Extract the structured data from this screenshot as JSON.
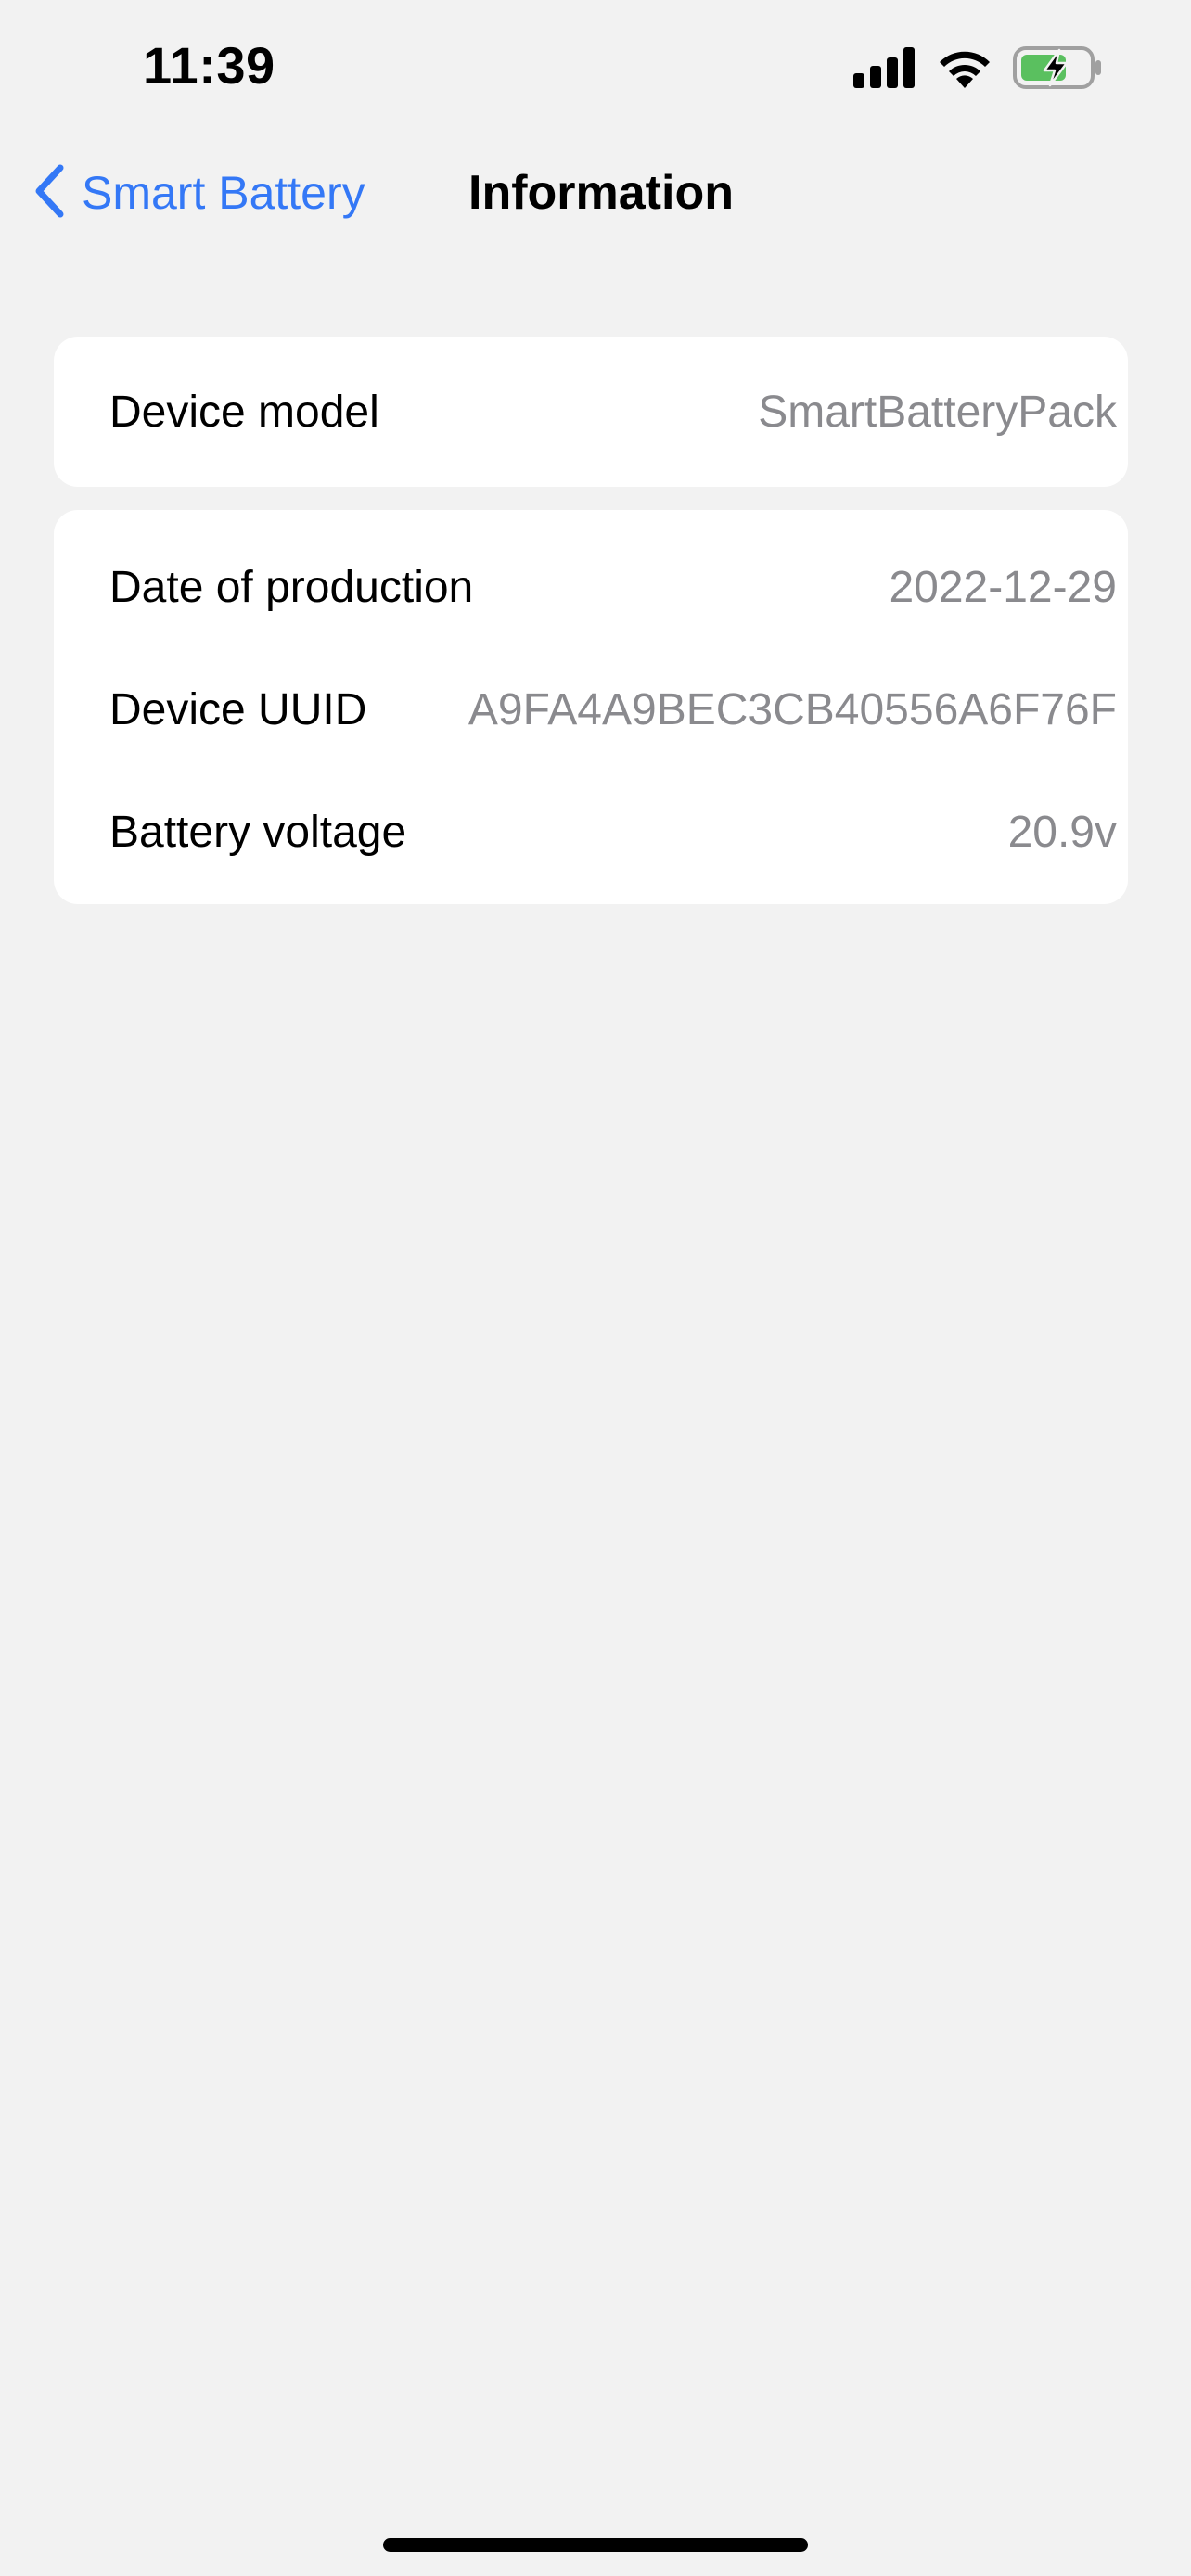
{
  "status_bar": {
    "time": "11:39",
    "icons": [
      "cellular-signal-icon",
      "wifi-icon",
      "battery-charging-icon"
    ],
    "battery_color": "#5ac05f"
  },
  "nav": {
    "back_label": "Smart Battery",
    "back_icon": "chevron-left-icon",
    "title": "Information",
    "accent_color": "#3478f6"
  },
  "groups": [
    {
      "rows": [
        {
          "label": "Device model",
          "value": "SmartBatteryPack"
        }
      ]
    },
    {
      "rows": [
        {
          "label": "Date of production",
          "value": "2022-12-29"
        },
        {
          "label": "Device UUID",
          "value": "A9FA4A9BEC3CB40556A6F76F"
        },
        {
          "label": "Battery voltage",
          "value": "20.9v"
        }
      ]
    }
  ]
}
